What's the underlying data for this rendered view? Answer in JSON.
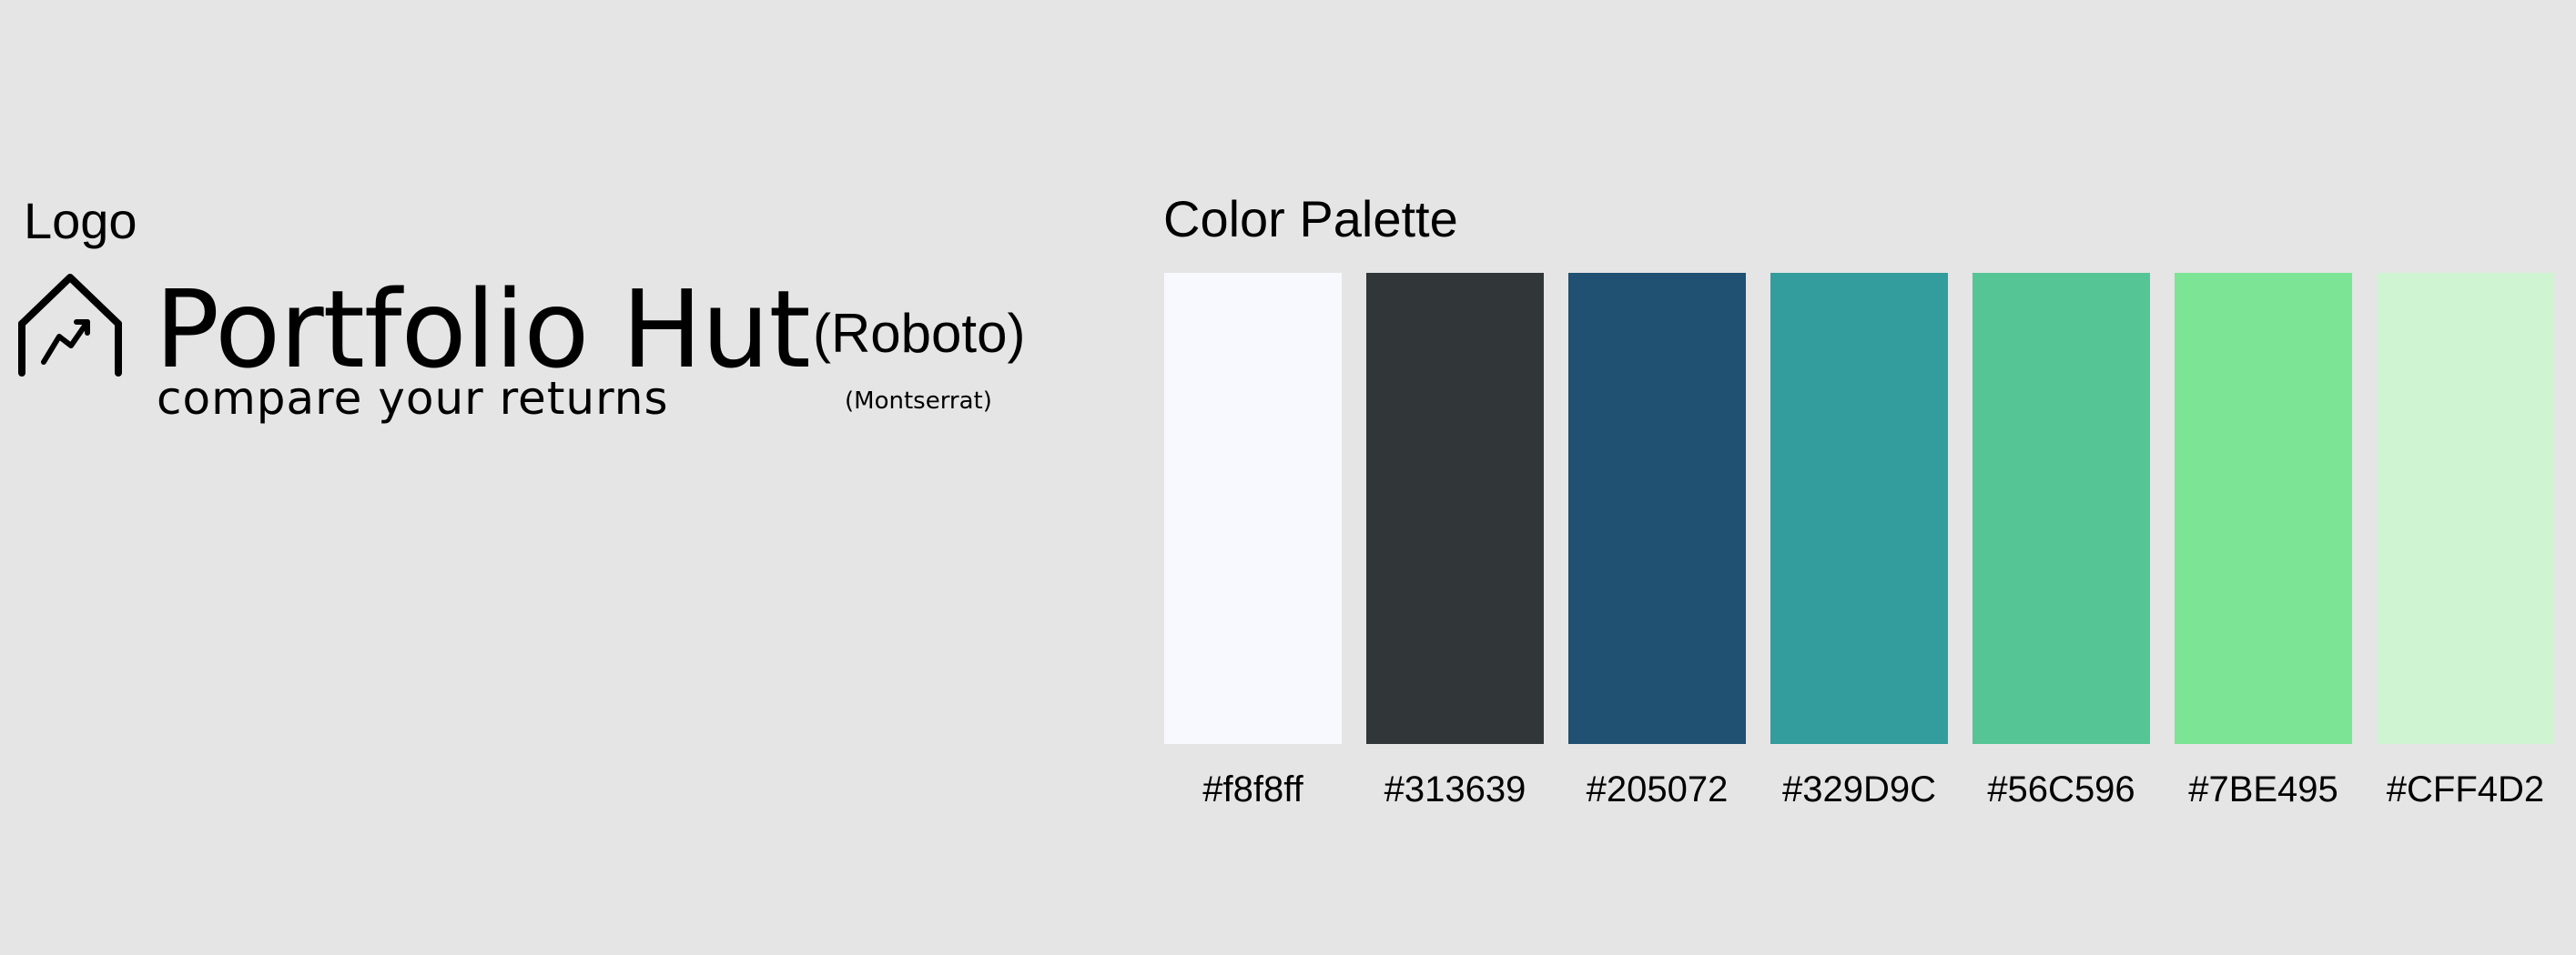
{
  "logo_section": {
    "heading": "Logo",
    "icon": "house-chart-icon",
    "brand_name": "Portfolio Hut",
    "tagline": "compare your returns",
    "heading_font_note": "(Roboto)",
    "tagline_font_note": "(Montserrat)"
  },
  "palette_section": {
    "heading": "Color Palette",
    "colors": [
      {
        "hex": "#f8f8ff",
        "label": "#f8f8ff"
      },
      {
        "hex": "#313639",
        "label": "#313639"
      },
      {
        "hex": "#205072",
        "label": "#205072"
      },
      {
        "hex": "#329D9C",
        "label": "#329D9C"
      },
      {
        "hex": "#56C596",
        "label": "#56C596"
      },
      {
        "hex": "#7BE495",
        "label": "#7BE495"
      },
      {
        "hex": "#CFF4D2",
        "label": "#CFF4D2"
      }
    ]
  }
}
